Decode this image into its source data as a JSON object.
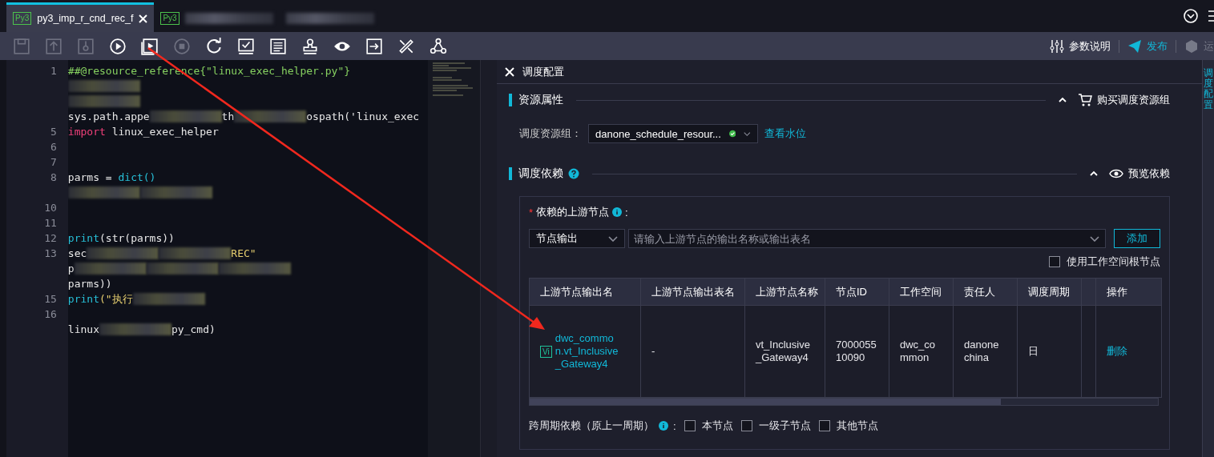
{
  "tabs": [
    {
      "label": "py3_imp_r_cnd_rec_f",
      "badge": "Py3",
      "selected": true
    },
    {
      "badge": "Py3",
      "selected": false
    },
    {
      "selected": false
    }
  ],
  "toolbar": {
    "tools": [
      {
        "kind": "save",
        "disabled": true
      },
      {
        "kind": "upload",
        "disabled": true
      },
      {
        "kind": "key",
        "disabled": true
      },
      {
        "kind": "run",
        "disabled": false
      },
      {
        "kind": "run-params",
        "disabled": false
      },
      {
        "kind": "stop",
        "disabled": true
      },
      {
        "kind": "refresh",
        "disabled": false
      },
      {
        "kind": "check",
        "disabled": false
      },
      {
        "kind": "format",
        "disabled": false
      },
      {
        "kind": "stamp",
        "disabled": false
      },
      {
        "kind": "view",
        "disabled": false
      },
      {
        "kind": "export",
        "disabled": false
      },
      {
        "kind": "tools",
        "disabled": false
      },
      {
        "kind": "graph",
        "disabled": false
      }
    ],
    "actions": [
      {
        "kind": "params",
        "label": "参数说明",
        "disabled": false
      },
      {
        "kind": "publish",
        "label": "发布",
        "disabled": false
      },
      {
        "kind": "ops",
        "label": "运",
        "disabled": true
      }
    ]
  },
  "editor": {
    "lines": [
      {
        "number": "1",
        "segments": [
          {
            "kind": "comment",
            "text": "##@resource_reference{\"linux_exec_helper.py\"}"
          }
        ]
      },
      {
        "segments": [
          {
            "kind": "redacted"
          }
        ]
      },
      {
        "segments": [
          {
            "kind": "redacted"
          }
        ]
      },
      {
        "segments": [
          {
            "kind": "plain",
            "text": "sys.path.appe"
          },
          {
            "kind": "redacted"
          },
          {
            "kind": "plain",
            "text": "th"
          },
          {
            "kind": "redacted"
          },
          {
            "kind": "plain",
            "text": "ospath('linux_exec"
          }
        ]
      },
      {
        "number": "5",
        "segments": [
          {
            "kind": "keyword",
            "text": "import"
          },
          {
            "kind": "plain",
            "text": " linux_exec_helper"
          }
        ]
      },
      {
        "number": "6"
      },
      {
        "number": "7"
      },
      {
        "number": "8",
        "segments": [
          {
            "kind": "plain",
            "text": "parms = "
          },
          {
            "kind": "func",
            "text": "dict()"
          }
        ]
      },
      {
        "segments": [
          {
            "kind": "redacted"
          },
          {
            "kind": "redacted"
          }
        ]
      },
      {
        "number": "10"
      },
      {
        "number": "11"
      },
      {
        "number": "12",
        "segments": [
          {
            "kind": "func",
            "text": "print"
          },
          {
            "kind": "plain",
            "text": "(str(parms))"
          }
        ]
      },
      {
        "number": "13",
        "segments": [
          {
            "kind": "plain",
            "text": "sec"
          },
          {
            "kind": "redacted"
          },
          {
            "kind": "redacted"
          },
          {
            "kind": "string",
            "text": "REC\""
          }
        ]
      },
      {
        "segments": [
          {
            "kind": "plain",
            "text": "p"
          },
          {
            "kind": "redacted"
          },
          {
            "kind": "redacted"
          },
          {
            "kind": "redacted"
          }
        ]
      },
      {
        "segments": [
          {
            "kind": "plain",
            "text": "parms))"
          }
        ]
      },
      {
        "number": "15",
        "segments": [
          {
            "kind": "func",
            "text": "print"
          },
          {
            "kind": "string",
            "text": "(\"执行"
          },
          {
            "kind": "redacted"
          }
        ]
      },
      {
        "number": "16"
      },
      {
        "segments": [
          {
            "kind": "plain",
            "text": "linux"
          },
          {
            "kind": "redacted"
          },
          {
            "kind": "plain",
            "text": "py_cmd)"
          }
        ]
      }
    ]
  },
  "panel": {
    "title": "调度配置",
    "resource": {
      "title": "资源属性",
      "expanded": true,
      "action": "购买调度资源组",
      "field_label": "调度资源组：",
      "group_value": "danone_schedule_resour...",
      "group_ok": true,
      "link": "查看水位"
    },
    "dependency": {
      "title": "调度依赖",
      "expanded": true,
      "action": "预览依赖",
      "upstream_label": "依赖的上游节点",
      "required_mark": "*",
      "colon": ":",
      "type_value": "节点输出",
      "search_placeholder": "请输入上游节点的输出名称或输出表名",
      "add_button": "添加",
      "root_checkbox": {
        "label": "使用工作空间根节点",
        "checked": false
      },
      "table": {
        "columns": [
          "上游节点输出名",
          "上游节点输出表名",
          "上游节点名称",
          "节点ID",
          "工作空间",
          "责任人",
          "调度周期",
          null,
          "操作"
        ],
        "rows": [
          {
            "badge": "Vi",
            "output_name": "dwc_common.vt_Inclusive_Gateway4",
            "table_name": "-",
            "node_name": "vt_Inclusive_Gateway4",
            "node_id": "700005510090",
            "workspace": "dwc_common",
            "owner": "danone china",
            "cycle": "日",
            "action": "删除"
          }
        ]
      },
      "cross_cycle": {
        "label": "跨周期依赖（原上一周期）",
        "colon": ":",
        "options": [
          {
            "label": "本节点",
            "checked": false
          },
          {
            "label": "一级子节点",
            "checked": false
          },
          {
            "label": "其他节点",
            "checked": false
          }
        ]
      }
    }
  },
  "side_strip": {
    "label": "调度配置"
  }
}
